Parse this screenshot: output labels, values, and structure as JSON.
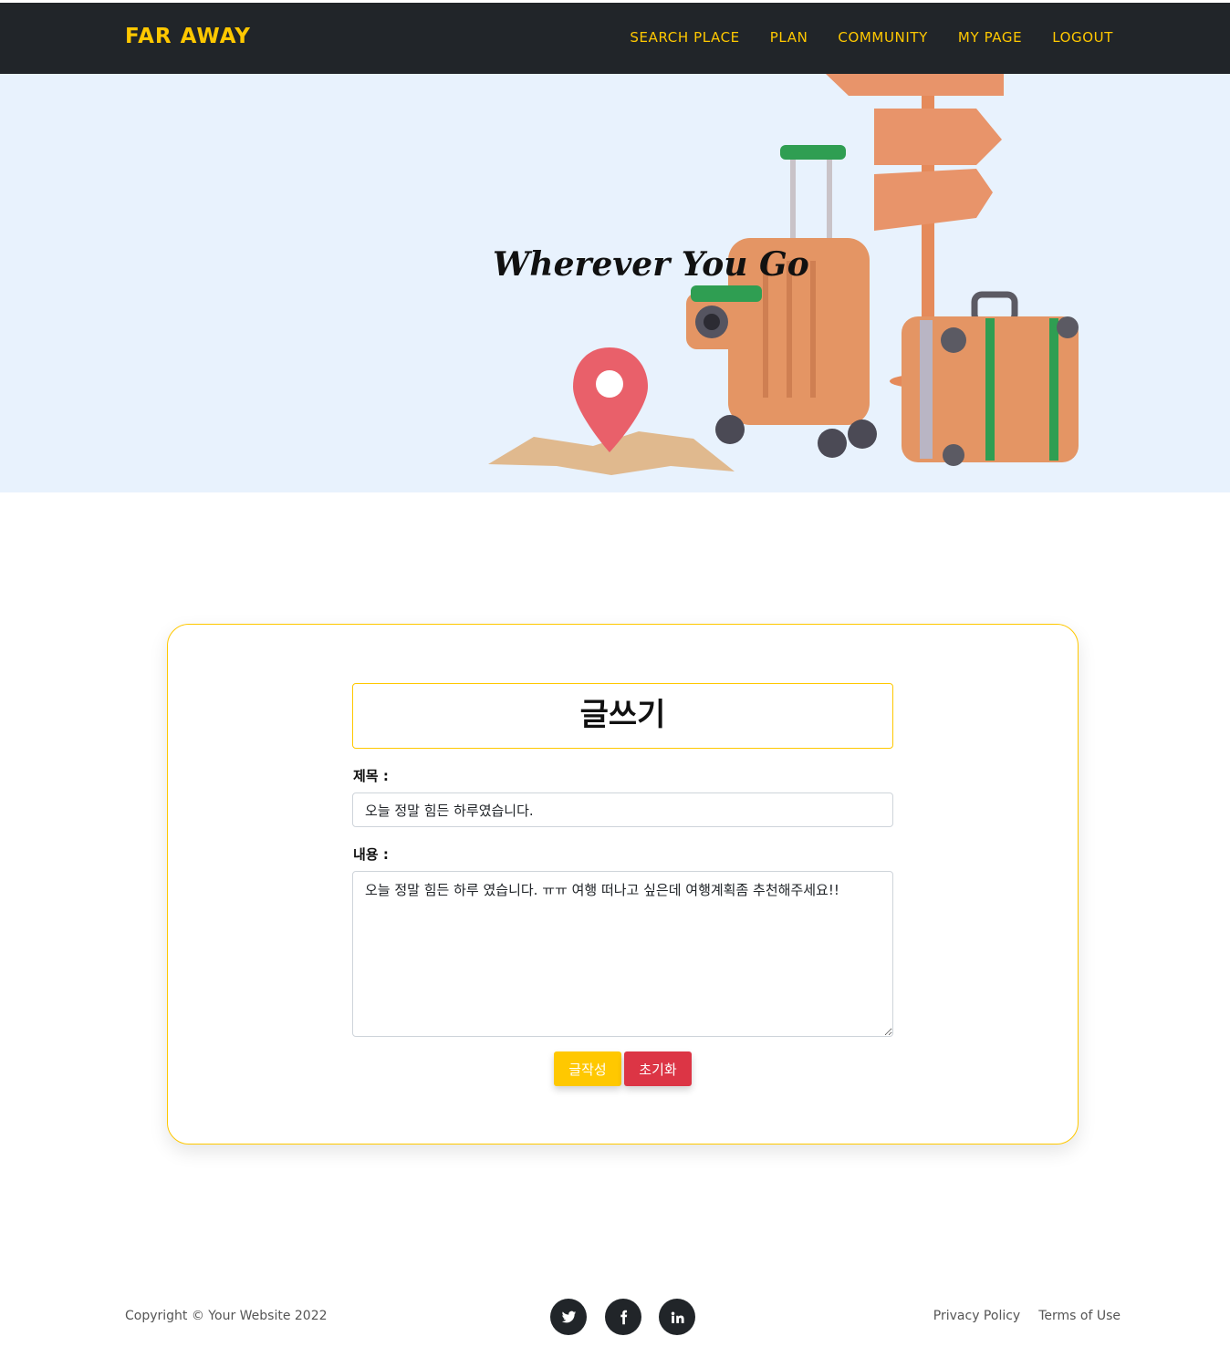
{
  "nav": {
    "brand": "FAR AWAY",
    "items": [
      {
        "label": "SEARCH PLACE"
      },
      {
        "label": "PLAN"
      },
      {
        "label": "COMMUNITY"
      },
      {
        "label": "MY PAGE"
      },
      {
        "label": "LOGOUT"
      }
    ]
  },
  "hero": {
    "title": "Wherever You Go"
  },
  "form": {
    "heading": "글쓰기",
    "title_label": "제목 :",
    "title_value": "오늘 정말 힘든 하루였습니다.",
    "content_label": "내용 :",
    "content_value": "오늘 정말 힘든 하루 였습니다. ㅠㅠ 여행 떠나고 싶은데 여행계획좀 추천해주세요!!",
    "submit_label": "글작성",
    "reset_label": "초기화"
  },
  "footer": {
    "copyright": "Copyright © Your Website 2022",
    "social": [
      "twitter-icon",
      "facebook-icon",
      "linkedin-icon"
    ],
    "links": [
      {
        "label": "Privacy Policy"
      },
      {
        "label": "Terms of Use"
      }
    ]
  },
  "colors": {
    "accent": "#ffc800",
    "danger": "#dc3545",
    "navbar": "#212529",
    "hero_bg": "#e8f2fd"
  }
}
